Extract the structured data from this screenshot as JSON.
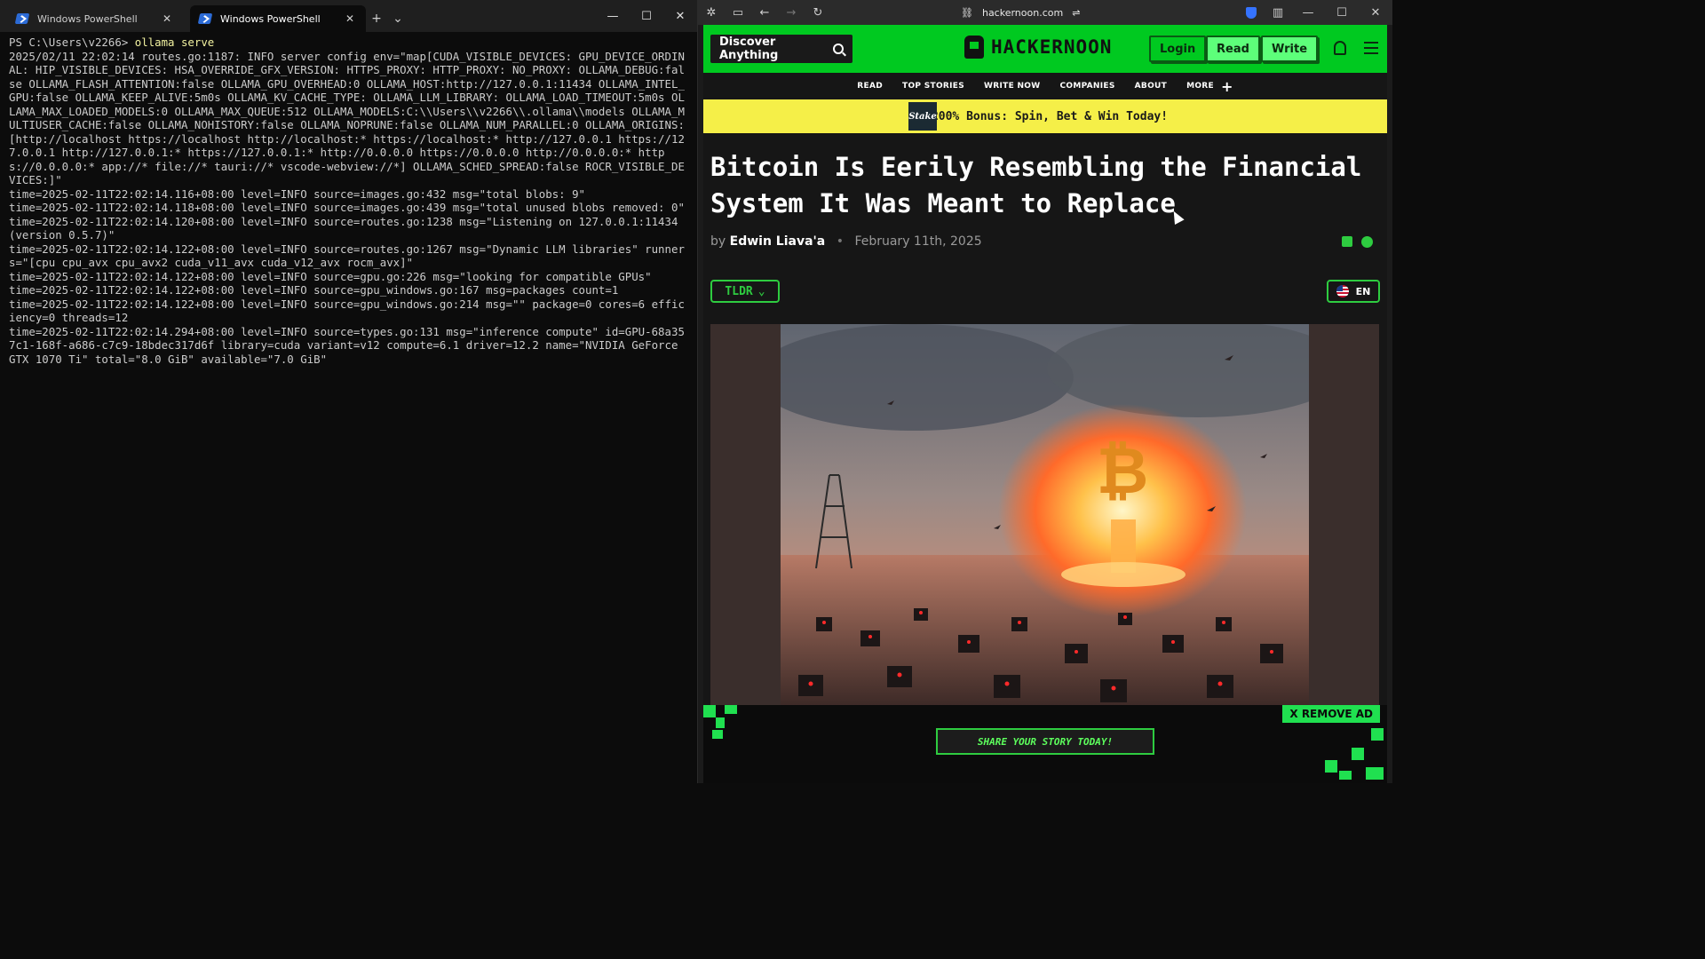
{
  "terminal": {
    "tabs": [
      {
        "label": "Windows PowerShell",
        "active": false
      },
      {
        "label": "Windows PowerShell",
        "active": true
      }
    ],
    "new_tab": "+",
    "dropdown": "⌄",
    "prompt": "PS C:\\Users\\v2266> ",
    "command": "ollama serve",
    "output": [
      "2025/02/11 22:02:14 routes.go:1187: INFO server config env=\"map[CUDA_VISIBLE_DEVICES: GPU_DEVICE_ORDINAL: HIP_VISIBLE_DEVICES: HSA_OVERRIDE_GFX_VERSION: HTTPS_PROXY: HTTP_PROXY: NO_PROXY: OLLAMA_DEBUG:false OLLAMA_FLASH_ATTENTION:false OLLAMA_GPU_OVERHEAD:0 OLLAMA_HOST:http://127.0.0.1:11434 OLLAMA_INTEL_GPU:false OLLAMA_KEEP_ALIVE:5m0s OLLAMA_KV_CACHE_TYPE: OLLAMA_LLM_LIBRARY: OLLAMA_LOAD_TIMEOUT:5m0s OLLAMA_MAX_LOADED_MODELS:0 OLLAMA_MAX_QUEUE:512 OLLAMA_MODELS:C:\\\\Users\\\\v2266\\\\.ollama\\\\models OLLAMA_MULTIUSER_CACHE:false OLLAMA_NOHISTORY:false OLLAMA_NOPRUNE:false OLLAMA_NUM_PARALLEL:0 OLLAMA_ORIGINS:[http://localhost https://localhost http://localhost:* https://localhost:* http://127.0.0.1 https://127.0.0.1 http://127.0.0.1:* https://127.0.0.1:* http://0.0.0.0 https://0.0.0.0 http://0.0.0.0:* https://0.0.0.0:* app://* file://* tauri://* vscode-webview://*] OLLAMA_SCHED_SPREAD:false ROCR_VISIBLE_DEVICES:]\"",
      "time=2025-02-11T22:02:14.116+08:00 level=INFO source=images.go:432 msg=\"total blobs: 9\"",
      "time=2025-02-11T22:02:14.118+08:00 level=INFO source=images.go:439 msg=\"total unused blobs removed: 0\"",
      "time=2025-02-11T22:02:14.120+08:00 level=INFO source=routes.go:1238 msg=\"Listening on 127.0.0.1:11434 (version 0.5.7)\"",
      "time=2025-02-11T22:02:14.122+08:00 level=INFO source=routes.go:1267 msg=\"Dynamic LLM libraries\" runners=\"[cpu cpu_avx cpu_avx2 cuda_v11_avx cuda_v12_avx rocm_avx]\"",
      "time=2025-02-11T22:02:14.122+08:00 level=INFO source=gpu.go:226 msg=\"looking for compatible GPUs\"",
      "time=2025-02-11T22:02:14.122+08:00 level=INFO source=gpu_windows.go:167 msg=packages count=1",
      "time=2025-02-11T22:02:14.122+08:00 level=INFO source=gpu_windows.go:214 msg=\"\" package=0 cores=6 efficiency=0 threads=12",
      "time=2025-02-11T22:02:14.294+08:00 level=INFO source=types.go:131 msg=\"inference compute\" id=GPU-68a357c1-168f-a686-c7c9-18bdec317d6f library=cuda variant=v12 compute=6.1 driver=12.2 name=\"NVIDIA GeForce GTX 1070 Ti\" total=\"8.0 GiB\" available=\"7.0 GiB\""
    ]
  },
  "browser": {
    "url": "hackernoon.com"
  },
  "hackernoon": {
    "search_label": "Discover Anything",
    "logo_text": "HACKERNOON",
    "login": "Login",
    "read": "Read",
    "write": "Write",
    "nav": [
      "READ",
      "TOP STORIES",
      "WRITE NOW",
      "COMPANIES",
      "ABOUT",
      "MORE"
    ],
    "nav_more_icon": "+",
    "ad": {
      "brand": "Stake",
      "text": "200% Bonus: Spin, Bet & Win Today!"
    },
    "article": {
      "title": "Bitcoin Is Eerily Resembling the Financial System It Was Meant to Replace",
      "by": "by",
      "author": "Edwin Liava'a",
      "date": "February 11th, 2025",
      "tldr": "TLDR",
      "lang": "EN"
    },
    "bottom_ad": {
      "cta": "SHARE YOUR STORY TODAY!",
      "remove": "X REMOVE AD"
    }
  },
  "colors": {
    "brand_green": "#00c920",
    "ad_yellow": "#f5ef48"
  }
}
